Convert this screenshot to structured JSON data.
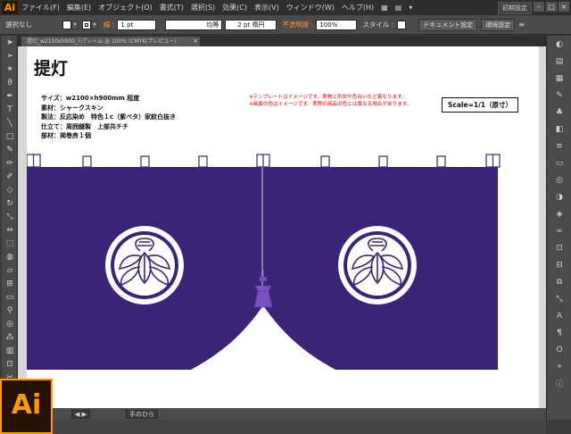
{
  "app": {
    "logo": "Ai",
    "big_logo": "Ai"
  },
  "menu": {
    "items": [
      "ファイル(F)",
      "編集(E)",
      "オブジェクト(O)",
      "書式(T)",
      "選択(S)",
      "効果(C)",
      "表示(V)",
      "ウィンドウ(W)",
      "ヘルプ(H)"
    ],
    "workspace": "初期設定"
  },
  "control": {
    "selection": "選択なし",
    "stroke_label": "線 :",
    "stroke_value": "1 pt",
    "stroke_profile": "均等",
    "brush": "2 pt 楕円",
    "opacity_label": "不透明度 :",
    "opacity_value": "100%",
    "style_label": "スタイル :",
    "doc_settings": "ドキュメント設定",
    "prefs": "環境設定"
  },
  "tab": {
    "title": "提灯_w2100xh900_ﾃﾝﾌﾟﾚｰﾄ.ai @ 100% (CMYK/プレビュー)"
  },
  "artwork": {
    "title": "提灯",
    "specs": [
      "サイズ：w2100×h900mm 程度",
      "素材：シャークスキン",
      "製法：反応染め　特色１c（紫ベタ）家紋白抜き",
      "仕立て：周囲縫製　上部共チチ",
      "部材：掲巻房１個"
    ],
    "notes": [
      "※テンプレートはイメージです。実物と形状や色合いなど異なります。",
      "※画面の色はイメージです。実際の商品の色とは異なる場合があります。"
    ],
    "scale": "Scale=1/1（原寸）",
    "noren_color": "#3b2478",
    "tassel_color": "#7a4fc0",
    "crest_count": 2
  },
  "status": {
    "tool": "手のひら"
  },
  "tools": [
    "selection-arrow-icon",
    "direct-select-icon",
    "magic-wand-icon",
    "lasso-icon",
    "pen-icon",
    "type-icon",
    "line-icon",
    "rectangle-icon",
    "paintbrush-icon",
    "pencil-icon",
    "blob-brush-icon",
    "eraser-icon",
    "rotate-icon",
    "scale-icon",
    "width-icon",
    "free-transform-icon",
    "shape-builder-icon",
    "perspective-icon",
    "mesh-icon",
    "gradient-icon",
    "eyedropper-icon",
    "blend-icon",
    "symbol-sprayer-icon",
    "graph-icon",
    "artboard-icon",
    "slice-icon",
    "hand-icon",
    "zoom-icon"
  ],
  "panels": [
    "color-panel-icon",
    "color-guide-icon",
    "swatches-icon",
    "brushes-icon",
    "symbols-icon",
    "graphic-styles-icon",
    "stroke-icon",
    "gradient-panel-icon",
    "transparency-icon",
    "appearance-icon",
    "layers-icon",
    "links-icon",
    "artboards-icon",
    "align-icon",
    "pathfinder-icon",
    "transform-icon",
    "character-icon",
    "paragraph-icon",
    "opentype-icon",
    "navigator-icon",
    "info-icon"
  ]
}
